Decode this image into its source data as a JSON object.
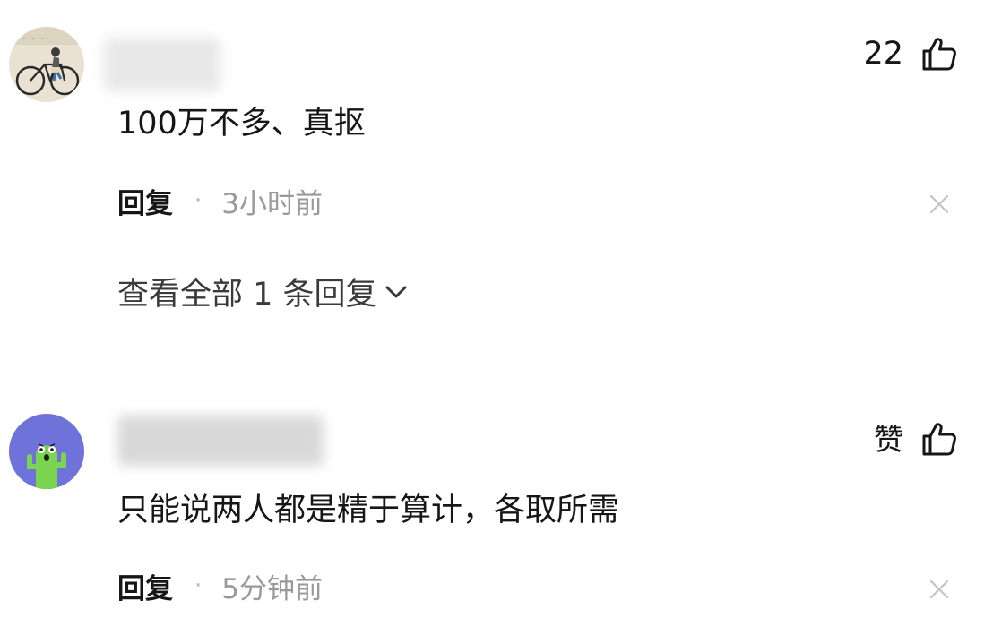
{
  "comments": [
    {
      "avatar": "vintage-bicycle-photo",
      "username_blurred": true,
      "like_count": "22",
      "text": "100万不多、真抠",
      "reply_label": "回复",
      "separator": "·",
      "time": "3小时前",
      "view_replies": "查看全部 1 条回复"
    },
    {
      "avatar": "cactus-cartoon",
      "username_blurred": true,
      "like_count": "赞",
      "text": "只能说两人都是精于算计，各取所需",
      "reply_label": "回复",
      "separator": "·",
      "time": "5分钟前"
    }
  ],
  "icons": {
    "like": "thumbs-up-icon",
    "dismiss": "close-icon",
    "expand": "chevron-down-icon"
  },
  "colors": {
    "text_primary": "#161616",
    "text_secondary": "#9a9a9a",
    "cactus_green": "#7bd44f",
    "cactus_bg": "#6f73d9"
  }
}
